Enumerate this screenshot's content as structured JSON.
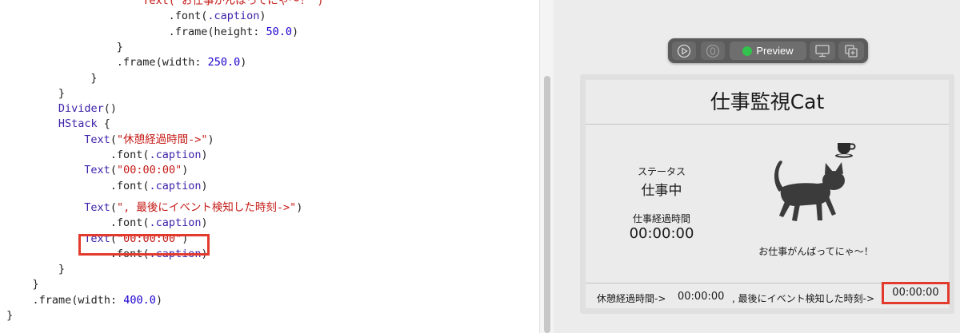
{
  "code": {
    "lines": [
      [
        {
          "t": "Text(\"お仕事がんばってにゃ〜！\")",
          "c": "tok-str"
        }
      ],
      [
        {
          "t": ".font(",
          "c": "tok-punc"
        },
        {
          "t": ".caption",
          "c": "tok-type"
        },
        {
          "t": ")",
          "c": "tok-punc"
        }
      ],
      [
        {
          "t": ".frame(height: ",
          "c": "tok-punc"
        },
        {
          "t": "50.0",
          "c": "tok-num"
        },
        {
          "t": ")",
          "c": "tok-punc"
        }
      ],
      [
        {
          "t": "}",
          "c": "tok-punc"
        }
      ],
      [
        {
          "t": ".frame(width: ",
          "c": "tok-punc"
        },
        {
          "t": "250.0",
          "c": "tok-num"
        },
        {
          "t": ")",
          "c": "tok-punc"
        }
      ],
      [
        {
          "t": "}",
          "c": "tok-punc"
        }
      ],
      [
        {
          "t": "}",
          "c": "tok-punc"
        }
      ],
      [
        {
          "t": "Divider",
          "c": "tok-type"
        },
        {
          "t": "()",
          "c": "tok-punc"
        }
      ],
      [
        {
          "t": "HStack",
          "c": "tok-type"
        },
        {
          "t": " {",
          "c": "tok-punc"
        }
      ],
      [
        {
          "t": "Text",
          "c": "tok-type"
        },
        {
          "t": "(",
          "c": "tok-punc"
        },
        {
          "t": "\"休憩経過時間->\"",
          "c": "tok-str"
        },
        {
          "t": ")",
          "c": "tok-punc"
        }
      ],
      [
        {
          "t": ".font(",
          "c": "tok-punc"
        },
        {
          "t": ".caption",
          "c": "tok-type"
        },
        {
          "t": ")",
          "c": "tok-punc"
        }
      ],
      [
        {
          "t": "Text",
          "c": "tok-type"
        },
        {
          "t": "(",
          "c": "tok-punc"
        },
        {
          "t": "\"00:00:00\"",
          "c": "tok-str"
        },
        {
          "t": ")",
          "c": "tok-punc"
        }
      ],
      [
        {
          "t": ".font(",
          "c": "tok-punc"
        },
        {
          "t": ".caption",
          "c": "tok-type"
        },
        {
          "t": ")",
          "c": "tok-punc"
        }
      ],
      [
        {
          "t": "Text",
          "c": "tok-type"
        },
        {
          "t": "(",
          "c": "tok-punc"
        },
        {
          "t": "\", 最後にイベント検知した時刻->\"",
          "c": "tok-str"
        },
        {
          "t": ")",
          "c": "tok-punc"
        }
      ],
      [
        {
          "t": ".font(",
          "c": "tok-punc"
        },
        {
          "t": ".caption",
          "c": "tok-type"
        },
        {
          "t": ")",
          "c": "tok-punc"
        }
      ],
      [
        {
          "t": "Text",
          "c": "tok-type"
        },
        {
          "t": "(",
          "c": "tok-punc"
        },
        {
          "t": "\"00:00:00\"",
          "c": "tok-str"
        },
        {
          "t": ")",
          "c": "tok-punc"
        }
      ],
      [
        {
          "t": ".font(",
          "c": "tok-punc"
        },
        {
          "t": ".caption",
          "c": "tok-type"
        },
        {
          "t": ")",
          "c": "tok-punc"
        }
      ],
      [
        {
          "t": "}",
          "c": "tok-punc"
        }
      ],
      [
        {
          "t": "}",
          "c": "tok-punc"
        }
      ],
      [
        {
          "t": ".frame(width: ",
          "c": "tok-punc"
        },
        {
          "t": "400.0",
          "c": "tok-num"
        },
        {
          "t": ")",
          "c": "tok-punc"
        }
      ],
      [
        {
          "t": "}",
          "c": "tok-punc"
        }
      ]
    ]
  },
  "toolbar": {
    "live_icon": "play-circle-icon",
    "select_icon": "select-icon",
    "preview_label": "Preview",
    "device_icon": "device-settings-icon",
    "duplicate_icon": "duplicate-icon",
    "status_color": "#32c24d"
  },
  "preview": {
    "title": "仕事監視Cat",
    "status_caption": "ステータス",
    "status_value": "仕事中",
    "work_caption": "仕事経過時間",
    "work_value": "00:00:00",
    "message": "お仕事がんばってにゃ〜！",
    "cup_icon": "coffee-cup-icon",
    "cat_icon": "cat-icon",
    "footer": {
      "rest_label": "休憩経過時間->",
      "rest_value": "00:00:00",
      "event_label": ", 最後にイベント検知した時刻->",
      "event_value": "00:00:00"
    }
  },
  "colors": {
    "highlight": "#e23b2e",
    "string": "#c41a16",
    "number": "#1c00cf",
    "type": "#3b1fa8"
  }
}
